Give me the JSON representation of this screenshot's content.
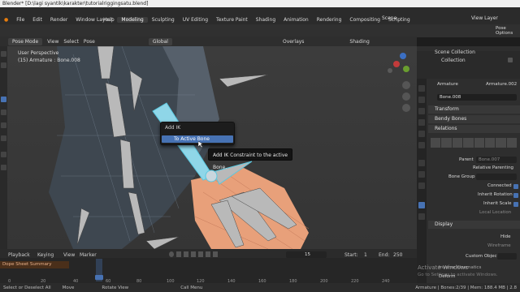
{
  "window": {
    "title": "Blender* [D:\\lagi syantik\\karakter\\tutorialriggingsatu.blend]"
  },
  "menu": [
    "File",
    "Edit",
    "Render",
    "Window",
    "Help"
  ],
  "workspaces": [
    "Layout",
    "Modeling",
    "Sculpting",
    "UV Editing",
    "Texture Paint",
    "Shading",
    "Animation",
    "Rendering",
    "Compositing",
    "Scripting"
  ],
  "active_workspace": "Modeling",
  "scene": {
    "label": "Scene",
    "view_layer": "View Layer"
  },
  "header3d": {
    "mode": "Pose Mode",
    "view": "View",
    "select": "Select",
    "pose": "Pose",
    "orientation": "Global",
    "overlays": "Overlays",
    "shading": "Shading",
    "pose_options": "Pose Options"
  },
  "viewport": {
    "perspective": "User Perspective",
    "object_info": "(15) Armature : Bone.008"
  },
  "context_menu": {
    "title": "Add IK",
    "item": "To Active Bone"
  },
  "tooltip": "Add IK Constraint to the active Bone.",
  "outliner": {
    "scene_collection": "Scene Collection",
    "collection": "Collection"
  },
  "properties": {
    "object": "Armature",
    "armature_data": "Armature.002",
    "bone": "Bone.008",
    "panels": [
      "Transform",
      "Bendy Bones",
      "Relations",
      "Display"
    ],
    "parent_label": "Parent",
    "parent_value": "Bone.007",
    "relative_parenting": "Relative Parenting",
    "bone_group": "Bone Group",
    "connected": "Connected",
    "inherit_rotation": "Inherit Rotation",
    "inherit_scale": "Inherit Scale",
    "local_location": "Local Location",
    "hide": "Hide",
    "wireframe": "Wireframe",
    "custom_object": "Custom Object",
    "activate": "Activate Windows",
    "activate_sub": "Go to Settings to activate Windows.",
    "inverse_kinematics": "Inverse Kinematics",
    "deform": "Deform"
  },
  "timeline": {
    "playback": "Playback",
    "keying": "Keying",
    "view": "View",
    "marker": "Marker",
    "current_frame": "15",
    "start_label": "Start:",
    "start": "1",
    "end_label": "End:",
    "end": "250",
    "summary": "Dope Sheet Summary",
    "frames": [
      "0",
      "20",
      "40",
      "60",
      "80",
      "100",
      "120",
      "140",
      "160",
      "180",
      "200",
      "220",
      "240"
    ]
  },
  "status": {
    "left": "Select or Deselect All",
    "move": "Move",
    "rotate": "Rotate View",
    "menu": "Call Menu",
    "right": "Armature | Bones:2/39 | Mem: 188.4 MB | 2.8"
  },
  "colors": {
    "accent": "#4772b3",
    "highlight_bone": "#5ac8e0",
    "skin": "#e8a07a"
  }
}
